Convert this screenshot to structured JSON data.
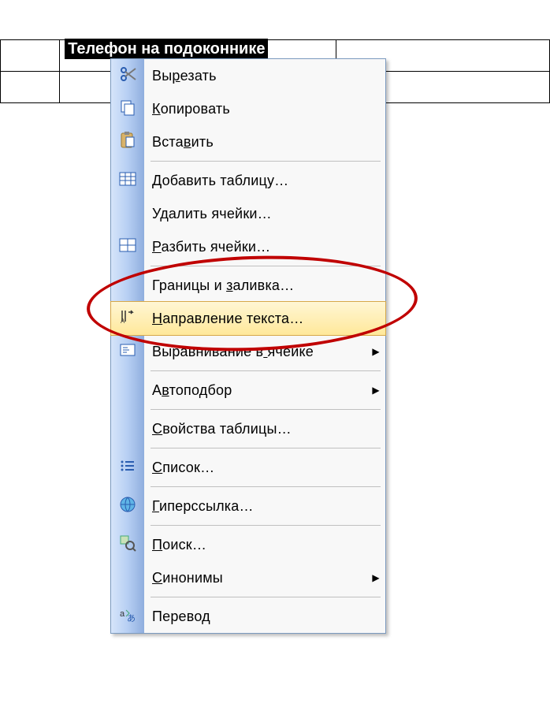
{
  "table": {
    "selected_cell_text": "Телефон на подоконнике"
  },
  "menu": {
    "cut": "Вырезать",
    "copy": "Копировать",
    "paste": "Вставить",
    "insert_table": "Добавить таблицу…",
    "delete_cells": "Удалить ячейки…",
    "split_cells": "Разбить ячейки…",
    "borders_shading": "Границы и заливка…",
    "text_direction": "Направление текста…",
    "cell_alignment": "Выравнивание в ячейке",
    "autofit": "Автоподбор",
    "table_properties": "Свойства таблицы…",
    "list": "Список…",
    "hyperlink": "Гиперссылка…",
    "search": "Поиск…",
    "synonyms": "Синонимы",
    "translate": "Перевод"
  },
  "underline_map": {
    "cut": 2,
    "copy": 0,
    "paste": 4,
    "insert_table": 0,
    "delete_cells": -1,
    "split_cells": 0,
    "borders_shading": 10,
    "text_direction": 0,
    "cell_alignment": 14,
    "autofit": 1,
    "table_properties": 0,
    "list": 0,
    "hyperlink": 0,
    "search": 0,
    "synonyms": 0,
    "translate": -1
  }
}
